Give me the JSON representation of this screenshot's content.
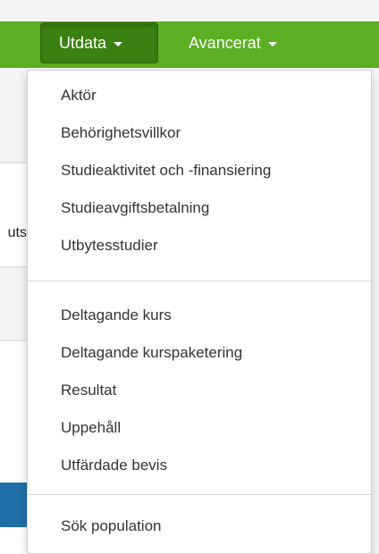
{
  "navbar": {
    "utdata_label": "Utdata",
    "avancerat_label": "Avancerat"
  },
  "background": {
    "partial_text": "uts"
  },
  "dropdown": {
    "group1": [
      "Aktör",
      "Behörighetsvillkor",
      "Studieaktivitet och -finansiering",
      "Studieavgiftsbetalning",
      "Utbytesstudier"
    ],
    "group2": [
      "Deltagande kurs",
      "Deltagande kurspaketering",
      "Resultat",
      "Uppehåll",
      "Utfärdade bevis"
    ],
    "group3": [
      "Sök population"
    ]
  },
  "colors": {
    "navbar_green": "#5cae22",
    "active_green": "#3b8012",
    "footer_blue": "#1f6fa8"
  }
}
